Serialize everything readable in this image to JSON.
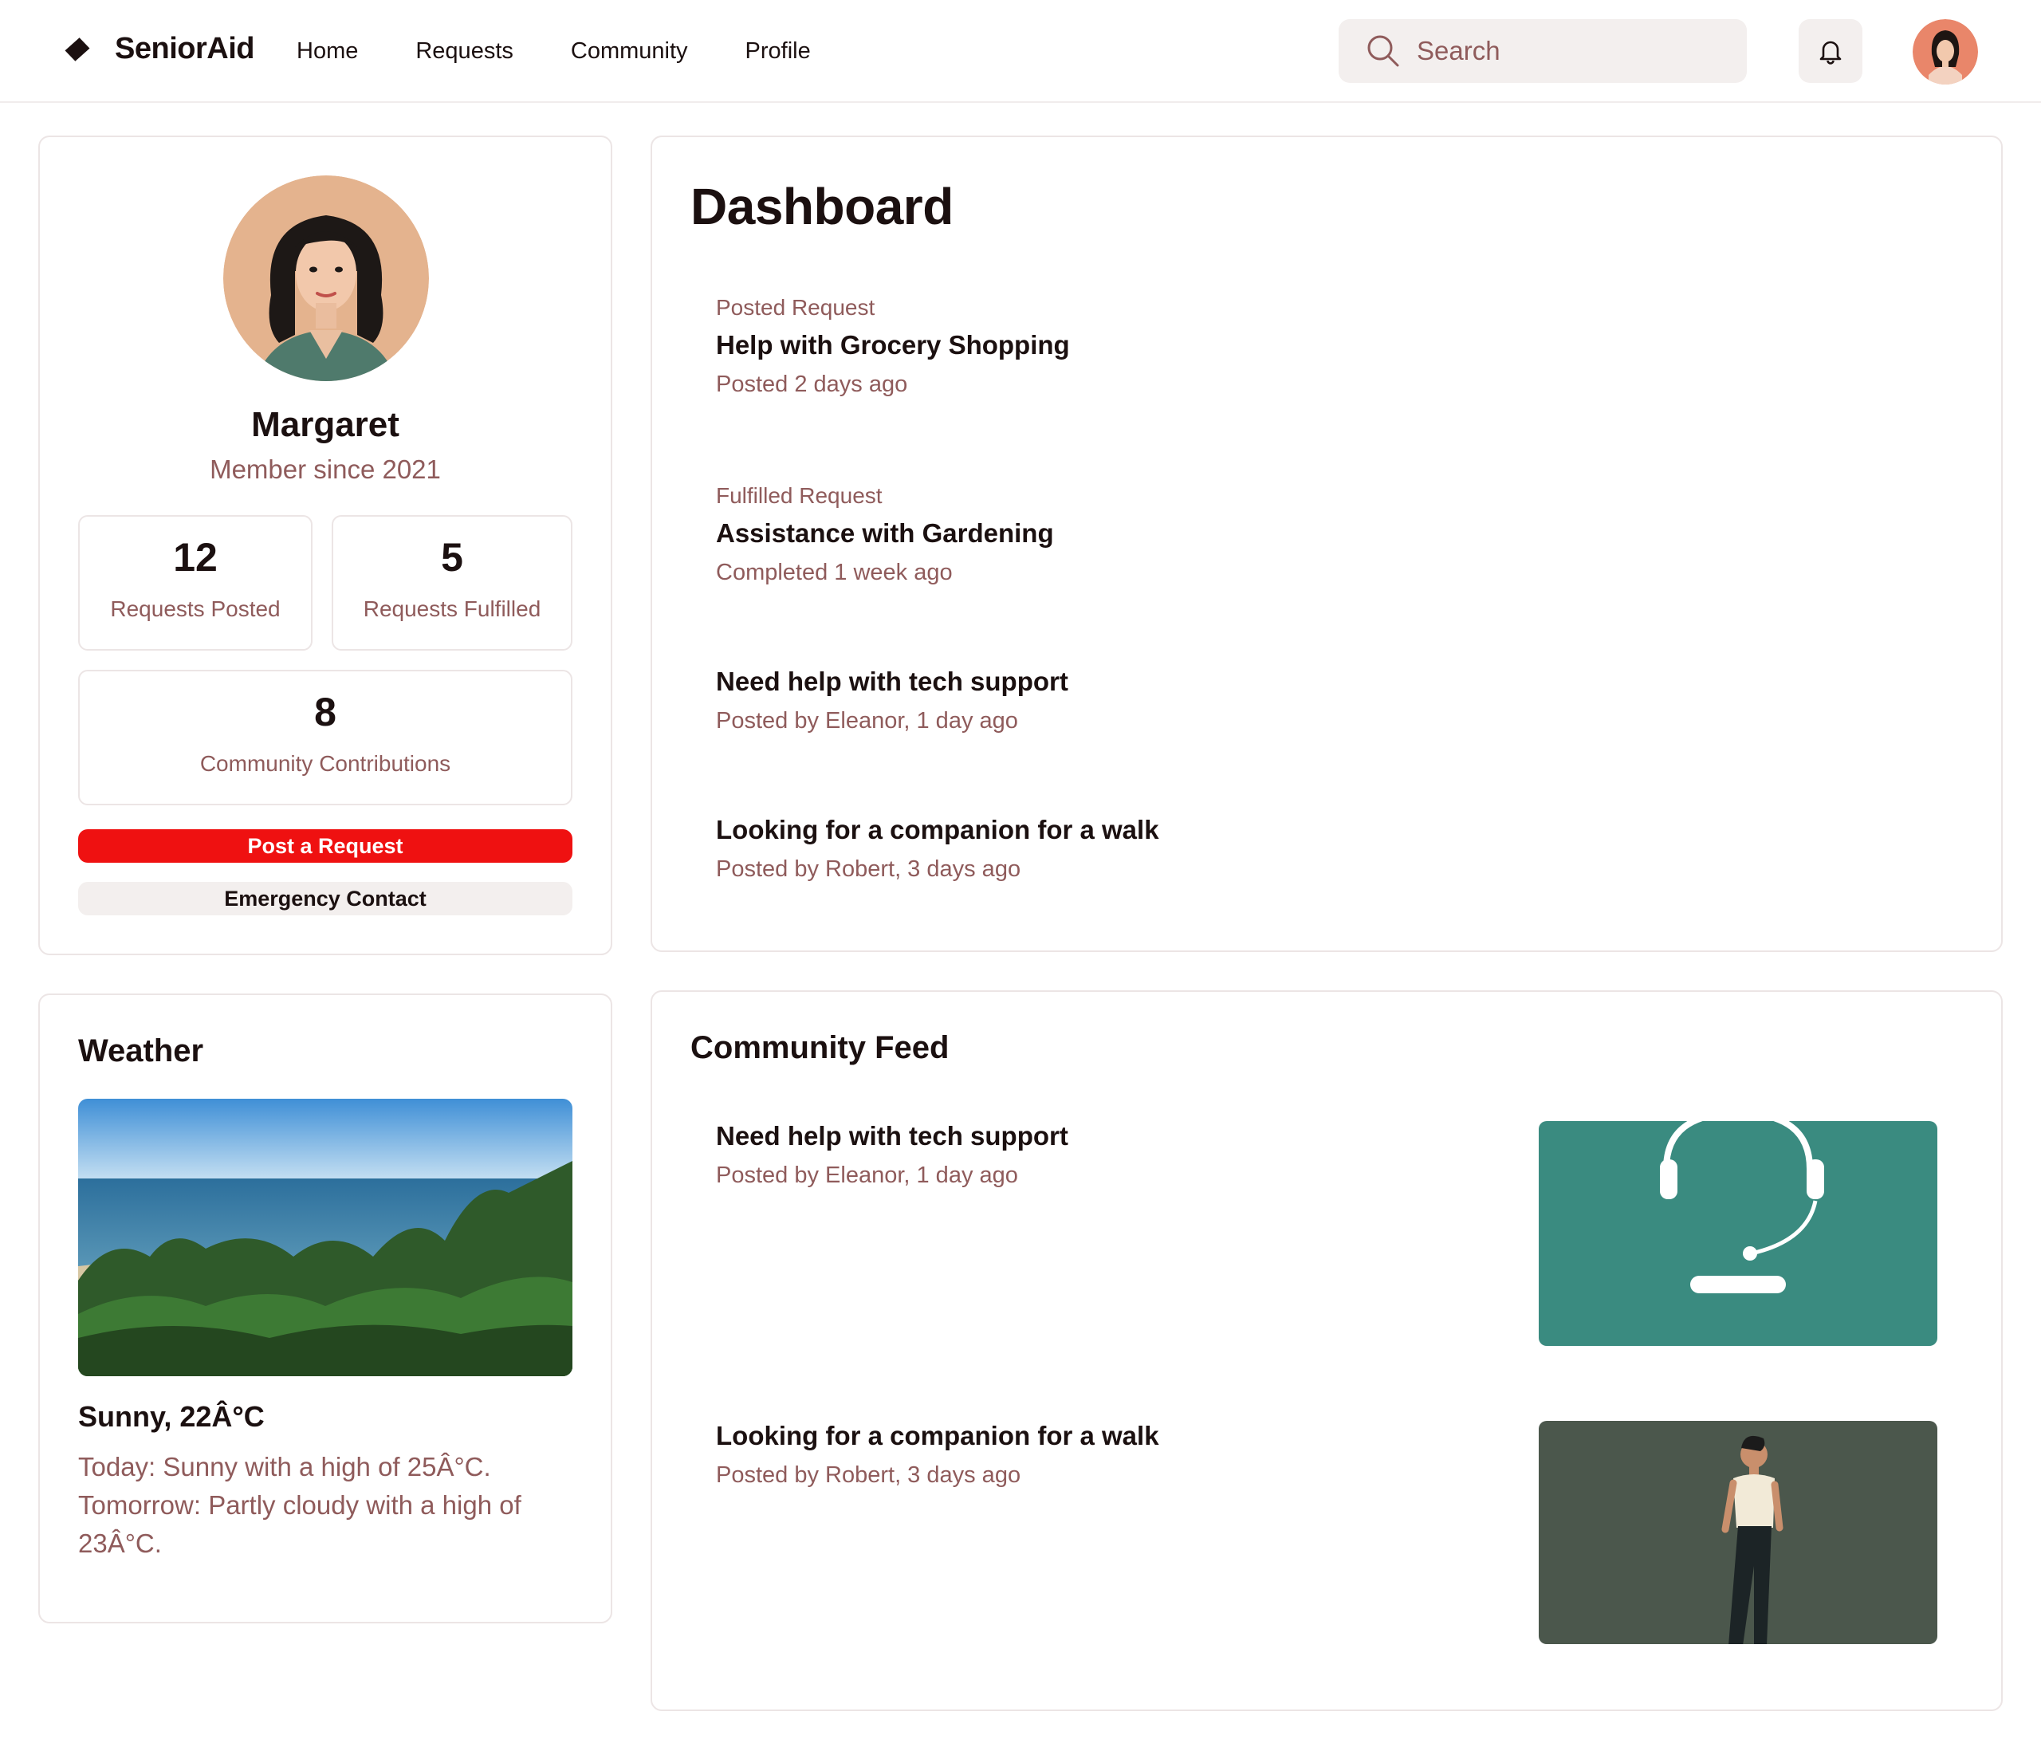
{
  "header": {
    "brand": "SeniorAid",
    "nav": [
      "Home",
      "Requests",
      "Community",
      "Profile"
    ],
    "search_placeholder": "Search"
  },
  "profile": {
    "name": "Margaret",
    "member_since": "Member since 2021",
    "stats": [
      {
        "value": "12",
        "label": "Requests Posted"
      },
      {
        "value": "5",
        "label": "Requests Fulfilled"
      },
      {
        "value": "8",
        "label": "Community Contributions"
      }
    ],
    "post_button": "Post a Request",
    "emergency_button": "Emergency Contact"
  },
  "dashboard": {
    "title": "Dashboard",
    "items": [
      {
        "kind": "Posted Request",
        "title": "Help with Grocery Shopping",
        "meta": "Posted 2 days ago"
      },
      {
        "kind": "Fulfilled Request",
        "title": "Assistance with Gardening",
        "meta": "Completed 1 week ago"
      },
      {
        "title": "Need help with tech support",
        "meta": "Posted by Eleanor, 1 day ago"
      },
      {
        "title": "Looking for a companion for a walk",
        "meta": "Posted by Robert, 3 days ago"
      }
    ]
  },
  "weather": {
    "title": "Weather",
    "condition": "Sunny, 22Â°C",
    "forecast": "Today: Sunny with a high of 25Â°C. Tomorrow: Partly cloudy with a high of 23Â°C."
  },
  "feed": {
    "title": "Community Feed",
    "items": [
      {
        "title": "Need help with tech support",
        "meta": "Posted by Eleanor, 1 day ago"
      },
      {
        "title": "Looking for a companion for a walk",
        "meta": "Posted by Robert, 3 days ago"
      }
    ]
  },
  "colors": {
    "accent_red": "#ef1111",
    "muted_text": "#8f5b5b",
    "soft_bg": "#f3efee",
    "feed_teal": "#3a8b80",
    "feed_olive": "#4b574c"
  }
}
